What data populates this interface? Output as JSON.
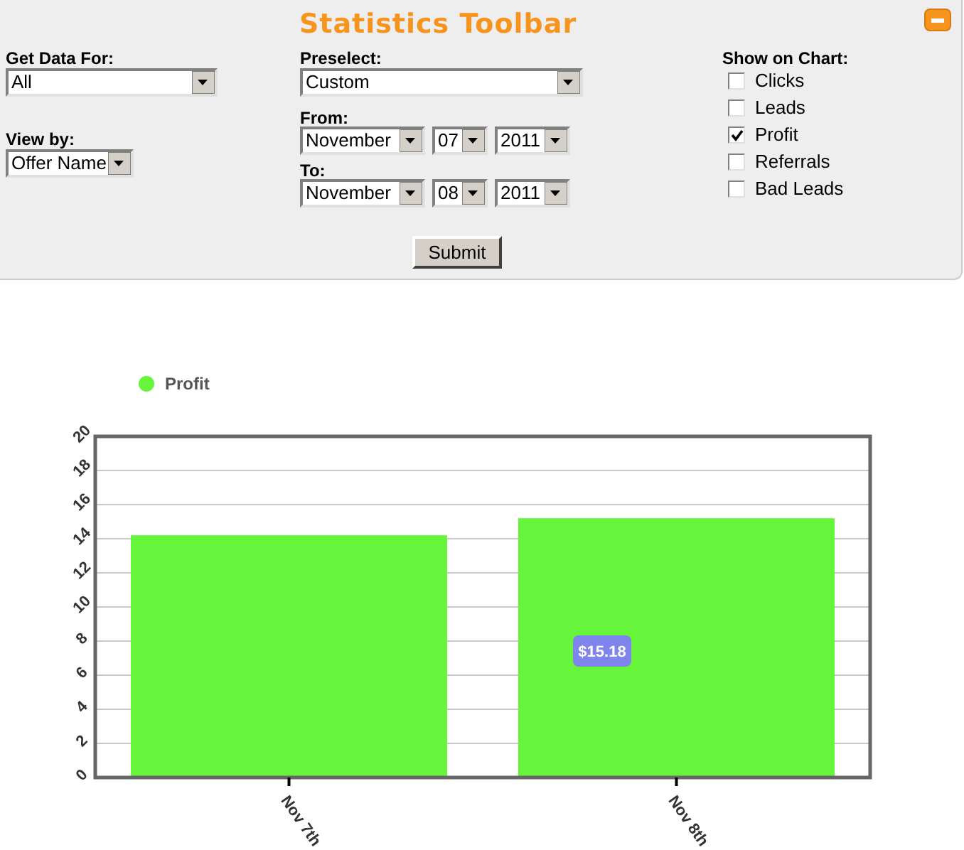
{
  "toolbar": {
    "title": "Statistics Toolbar",
    "get_data_for": {
      "label": "Get Data For:",
      "value": "All"
    },
    "view_by": {
      "label": "View by:",
      "value": "Offer Name"
    },
    "preselect": {
      "label": "Preselect:",
      "value": "Custom"
    },
    "from": {
      "label": "From:",
      "month": "November",
      "day": "07",
      "year": "2011"
    },
    "to": {
      "label": "To:",
      "month": "November",
      "day": "08",
      "year": "2011"
    },
    "show_on_chart": {
      "label": "Show on Chart:",
      "options": [
        {
          "label": "Clicks",
          "checked": false
        },
        {
          "label": "Leads",
          "checked": false
        },
        {
          "label": "Profit",
          "checked": true
        },
        {
          "label": "Referrals",
          "checked": false
        },
        {
          "label": "Bad Leads",
          "checked": false
        }
      ]
    },
    "submit": "Submit"
  },
  "chart": {
    "tooltip": "$15.18",
    "chart_data": {
      "type": "bar",
      "categories": [
        "Nov 7th",
        "Nov 8th"
      ],
      "series": [
        {
          "name": "Profit",
          "color": "#66f53a",
          "values": [
            14.2,
            15.2
          ]
        }
      ],
      "ylim": [
        0,
        20
      ],
      "yticks": [
        0,
        2,
        4,
        6,
        8,
        10,
        12,
        14,
        16,
        18,
        20
      ],
      "grid": true
    }
  }
}
